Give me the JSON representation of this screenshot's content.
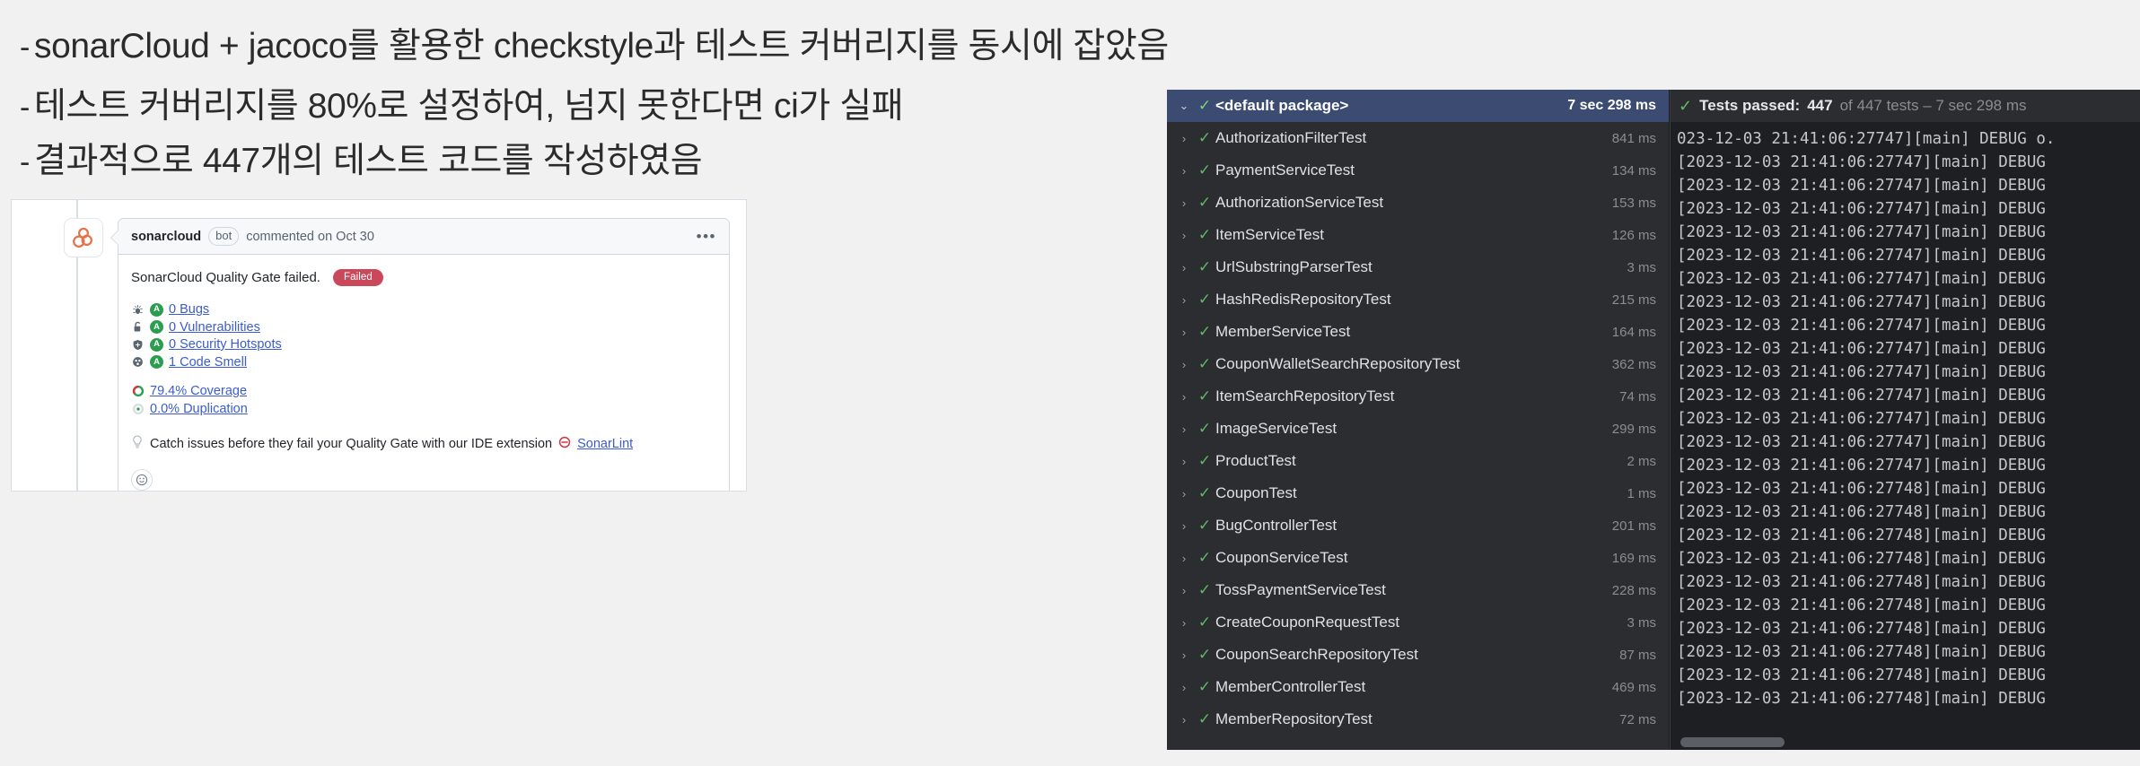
{
  "slide": {
    "bullets": [
      {
        "dash": "-",
        "text": "sonarCloud + jacoco를 활용한 checkstyle과 테스트 커버리지를 동시에 잡았음"
      },
      {
        "dash": "-",
        "text": "테스트 커버리지를 80%로 설정하여, 넘지 못한다면 ci가 실패"
      },
      {
        "dash": "-",
        "text": "결과적으로 447개의 테스트 코드를 작성하였음"
      }
    ]
  },
  "github_comment": {
    "author": "sonarcloud",
    "bot_badge": "bot",
    "meta": "commented on Oct 30",
    "menu_dots": "•••",
    "quality_gate_text": "SonarCloud Quality Gate failed.",
    "status_badge": "Failed",
    "status_badge_color": "#c9485b",
    "metrics": [
      {
        "icon": "bug-icon",
        "rating": "A",
        "label": "0 Bugs"
      },
      {
        "icon": "lock-open-icon",
        "rating": "A",
        "label": "0 Vulnerabilities"
      },
      {
        "icon": "shield-icon",
        "rating": "A",
        "label": "0 Security Hotspots"
      },
      {
        "icon": "code-smell-icon",
        "rating": "A",
        "label": "1 Code Smell"
      }
    ],
    "percent_metrics": [
      {
        "icon": "coverage-donut-icon",
        "label": "79.4% Coverage",
        "value": 79.4,
        "color": "#d4333f",
        "track": "#2a9d4f"
      },
      {
        "icon": "duplication-donut-icon",
        "label": "0.0% Duplication",
        "value": 0.0,
        "color": "#2a9d4f",
        "track": "#d9dde2"
      }
    ],
    "tip_icon": "lightbulb-icon",
    "tip_text": "Catch issues before they fail your Quality Gate with our IDE extension",
    "tip_badge_icon": "sonarlint-icon",
    "tip_link": "SonarLint",
    "reaction_icon": "emoji-smiley-icon",
    "link_color": "#3b5ccc"
  },
  "ide": {
    "tree": {
      "root": {
        "label": "<default package>",
        "time": "7 sec 298 ms",
        "chevron": "⌄",
        "status": "passed"
      },
      "items": [
        {
          "label": "AuthorizationFilterTest",
          "time": "841 ms"
        },
        {
          "label": "PaymentServiceTest",
          "time": "134 ms"
        },
        {
          "label": "AuthorizationServiceTest",
          "time": "153 ms"
        },
        {
          "label": "ItemServiceTest",
          "time": "126 ms"
        },
        {
          "label": "UrlSubstringParserTest",
          "time": "3 ms"
        },
        {
          "label": "HashRedisRepositoryTest",
          "time": "215 ms"
        },
        {
          "label": "MemberServiceTest",
          "time": "164 ms"
        },
        {
          "label": "CouponWalletSearchRepositoryTest",
          "time": "362 ms"
        },
        {
          "label": "ItemSearchRepositoryTest",
          "time": "74 ms"
        },
        {
          "label": "ImageServiceTest",
          "time": "299 ms"
        },
        {
          "label": "ProductTest",
          "time": "2 ms"
        },
        {
          "label": "CouponTest",
          "time": "1 ms"
        },
        {
          "label": "BugControllerTest",
          "time": "201 ms"
        },
        {
          "label": "CouponServiceTest",
          "time": "169 ms"
        },
        {
          "label": "TossPaymentServiceTest",
          "time": "228 ms"
        },
        {
          "label": "CreateCouponRequestTest",
          "time": "3 ms"
        },
        {
          "label": "CouponSearchRepositoryTest",
          "time": "87 ms"
        },
        {
          "label": "MemberControllerTest",
          "time": "469 ms"
        },
        {
          "label": "MemberRepositoryTest",
          "time": "72 ms"
        }
      ],
      "item_chevron": "›",
      "item_tick": "✓"
    },
    "console": {
      "status_tick": "✓",
      "status_prefix": "Tests passed:",
      "status_count": "447",
      "status_suffix": "of 447 tests – 7 sec 298 ms",
      "lines": [
        "023-12-03 21:41:06:27747][main] DEBUG o.",
        "[2023-12-03 21:41:06:27747][main] DEBUG",
        "[2023-12-03 21:41:06:27747][main] DEBUG",
        "[2023-12-03 21:41:06:27747][main] DEBUG",
        "[2023-12-03 21:41:06:27747][main] DEBUG",
        "[2023-12-03 21:41:06:27747][main] DEBUG",
        "[2023-12-03 21:41:06:27747][main] DEBUG",
        "[2023-12-03 21:41:06:27747][main] DEBUG",
        "[2023-12-03 21:41:06:27747][main] DEBUG",
        "[2023-12-03 21:41:06:27747][main] DEBUG",
        "[2023-12-03 21:41:06:27747][main] DEBUG",
        "[2023-12-03 21:41:06:27747][main] DEBUG",
        "[2023-12-03 21:41:06:27747][main] DEBUG",
        "[2023-12-03 21:41:06:27747][main] DEBUG",
        "[2023-12-03 21:41:06:27747][main] DEBUG",
        "[2023-12-03 21:41:06:27748][main] DEBUG",
        "[2023-12-03 21:41:06:27748][main] DEBUG",
        "[2023-12-03 21:41:06:27748][main] DEBUG",
        "[2023-12-03 21:41:06:27748][main] DEBUG",
        "[2023-12-03 21:41:06:27748][main] DEBUG",
        "[2023-12-03 21:41:06:27748][main] DEBUG",
        "[2023-12-03 21:41:06:27748][main] DEBUG",
        "[2023-12-03 21:41:06:27748][main] DEBUG",
        "[2023-12-03 21:41:06:27748][main] DEBUG",
        "[2023-12-03 21:41:06:27748][main] DEBUG"
      ]
    }
  }
}
